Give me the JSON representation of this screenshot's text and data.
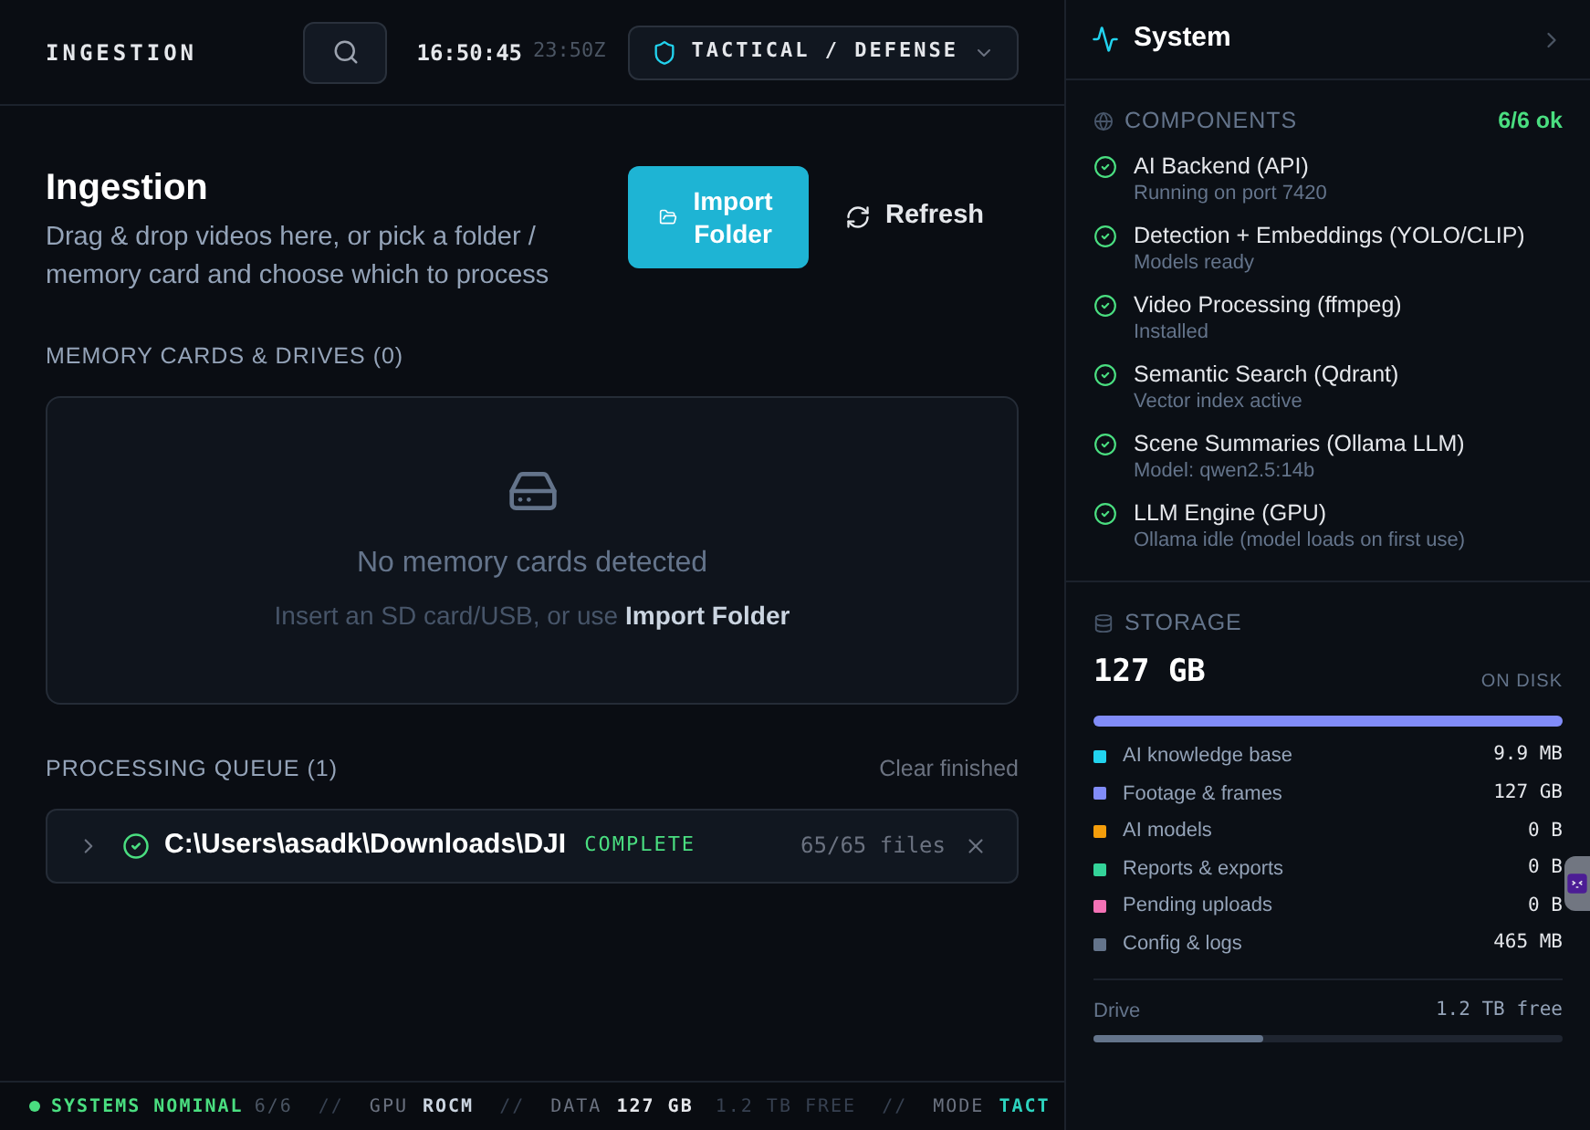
{
  "header": {
    "title": "INGESTION",
    "time": "16:50:45",
    "utc": "23:50Z",
    "mode": "TACTICAL / DEFENSE"
  },
  "page": {
    "title": "Ingestion",
    "subtitle": "Drag & drop videos here, or pick a folder / memory card and choose which to process",
    "import_button": "Import Folder",
    "refresh_button": "Refresh"
  },
  "drives": {
    "heading": "MEMORY CARDS & DRIVES (0)",
    "empty_title": "No memory cards detected",
    "empty_hint": "Insert an SD card/USB, or use **Import Folder**"
  },
  "queue": {
    "heading": "PROCESSING QUEUE (1)",
    "clear": "Clear finished",
    "items": [
      {
        "path": "C:\\Users\\asadk\\Downloads\\DJI",
        "status": "COMPLETE",
        "files": "65/65 files",
        "expanded": false
      }
    ]
  },
  "status_bar": {
    "state": "SYSTEMS NOMINAL",
    "count": "6/6",
    "sep": "//",
    "gpu_label": "GPU",
    "gpu": "ROCM",
    "data_label": "DATA",
    "data": "127 GB",
    "free": "1.2 TB FREE",
    "mode_label": "MODE",
    "mode": "TACT"
  },
  "system": {
    "title": "System",
    "components_heading": "COMPONENTS",
    "components_count": "6/6 ok",
    "components": [
      {
        "name": "AI Backend (API)",
        "detail": "Running on port 7420",
        "ok": true
      },
      {
        "name": "Detection + Embeddings (YOLO/CLIP)",
        "detail": "Models ready",
        "ok": true
      },
      {
        "name": "Video Processing (ffmpeg)",
        "detail": "Installed",
        "ok": true
      },
      {
        "name": "Semantic Search (Qdrant)",
        "detail": "Vector index active",
        "ok": true
      },
      {
        "name": "Scene Summaries (Ollama LLM)",
        "detail": "Model: qwen2.5:14b",
        "ok": true
      },
      {
        "name": "LLM Engine (GPU)",
        "detail": "Ollama idle (model loads on first use)",
        "ok": true
      }
    ],
    "storage_heading": "STORAGE",
    "storage_total": "127 GB",
    "storage_caption": "ON DISK",
    "usage_bar": {
      "level": 1
    },
    "storage_items": [
      {
        "label": "AI knowledge base",
        "value": "9.9 MB",
        "color": "#22d3ee"
      },
      {
        "label": "Footage & frames",
        "value": "127 GB",
        "color": "#818cf8"
      },
      {
        "label": "AI models",
        "value": "0 B",
        "color": "#f59e0b"
      },
      {
        "label": "Reports & exports",
        "value": "0 B",
        "color": "#34d399"
      },
      {
        "label": "Pending uploads",
        "value": "0 B",
        "color": "#f472b6"
      },
      {
        "label": "Config & logs",
        "value": "465 MB",
        "color": "#64748b"
      }
    ],
    "drive_label": "Drive",
    "drive_free": "1.2 TB free",
    "drive_bar": {
      "level": 0.36
    }
  }
}
